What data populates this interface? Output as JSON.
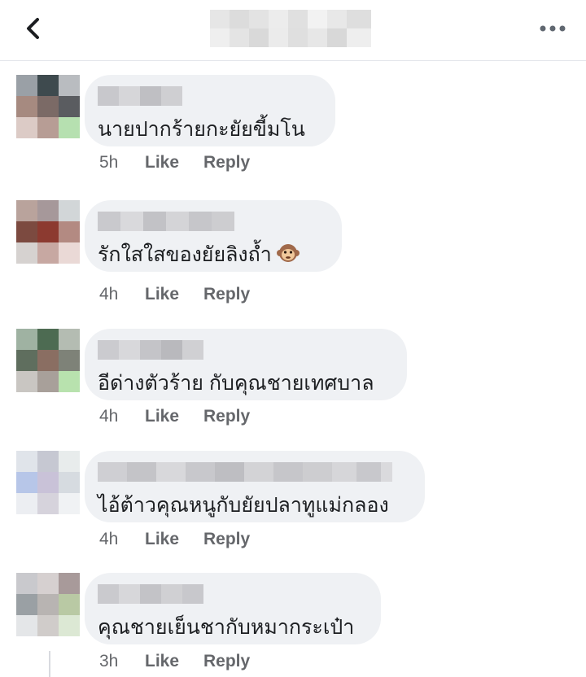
{
  "header": {
    "back_icon": "chevron-left-icon",
    "more_icon": "more-horizontal-icon"
  },
  "colors": {
    "bubble": "#eff1f4",
    "meta_text": "#65676b",
    "text": "#1c1e21"
  },
  "comments": [
    {
      "text": "นายปากร้ายกะยัยขี้มโน",
      "time": "5h",
      "like": "Like",
      "reply": "Reply"
    },
    {
      "text": "รักใสใสของยัยลิงถ้ำ",
      "emoji": "monkey-face-icon",
      "time": "4h",
      "like": "Like",
      "reply": "Reply"
    },
    {
      "text": "อีด่างตัวร้าย กับคุณชายเทศบาล",
      "time": "4h",
      "like": "Like",
      "reply": "Reply"
    },
    {
      "text": "ไอ้ต้าวคุณหนูกับยัยปลาทูแม่กลอง",
      "time": "4h",
      "like": "Like",
      "reply": "Reply"
    },
    {
      "text": "คุณชายเย็นชากับหมากระเป๋า",
      "time": "3h",
      "like": "Like",
      "reply": "Reply"
    }
  ]
}
